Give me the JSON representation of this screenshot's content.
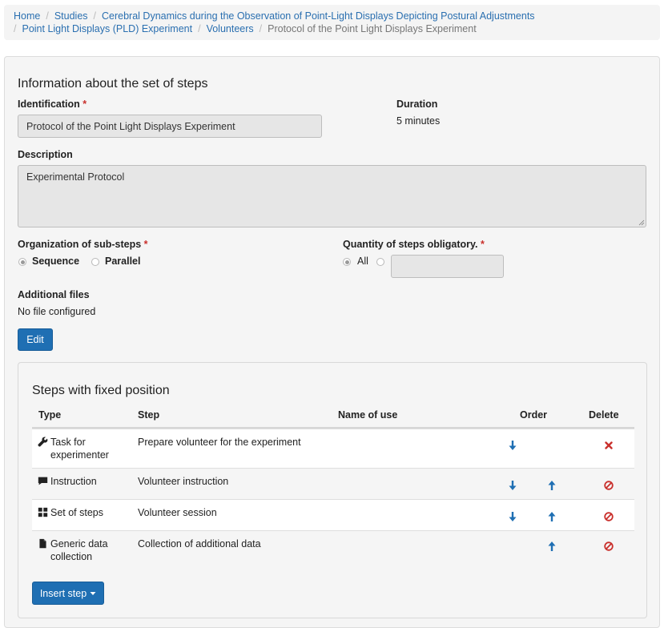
{
  "breadcrumb": {
    "items": [
      "Home",
      "Studies",
      "Cerebral Dynamics during the Observation of Point-Light Displays Depicting Postural Adjustments",
      "Point Light Displays (PLD) Experiment",
      "Volunteers"
    ],
    "current": "Protocol of the Point Light Displays Experiment"
  },
  "form": {
    "title": "Information about the set of steps",
    "identification_label": "Identification",
    "identification_value": "Protocol of the Point Light Displays Experiment",
    "duration_label": "Duration",
    "duration_value": "5 minutes",
    "description_label": "Description",
    "description_value": "Experimental Protocol",
    "organization_label": "Organization of sub-steps",
    "organization_options": [
      "Sequence",
      "Parallel"
    ],
    "organization_selected": "Sequence",
    "quantity_label": "Quantity of steps obligatory.",
    "quantity_options": [
      "All"
    ],
    "quantity_selected": "All",
    "quantity_value": "",
    "required_mark": "*",
    "files_label": "Additional files",
    "files_value": "No file configured",
    "edit_button": "Edit"
  },
  "steps": {
    "title": "Steps with fixed position",
    "columns": [
      "Type",
      "Step",
      "Name of use",
      "Order",
      "Delete"
    ],
    "rows": [
      {
        "type": "Task for experimenter",
        "type_icon": "wrench-icon",
        "step": "Prepare volunteer for the experiment",
        "name_of_use": "",
        "down": true,
        "up": false,
        "delete_icon": "remove-icon"
      },
      {
        "type": "Instruction",
        "type_icon": "comment-icon",
        "step": "Volunteer instruction",
        "name_of_use": "",
        "down": true,
        "up": true,
        "delete_icon": "ban-icon"
      },
      {
        "type": "Set of steps",
        "type_icon": "grid-icon",
        "step": "Volunteer session",
        "name_of_use": "",
        "down": true,
        "up": true,
        "delete_icon": "ban-icon"
      },
      {
        "type": "Generic data collection",
        "type_icon": "file-icon",
        "step": "Collection of additional data",
        "name_of_use": "",
        "down": false,
        "up": true,
        "delete_icon": "ban-icon"
      }
    ],
    "insert_button": "Insert step"
  },
  "colors": {
    "link": "#2a6fb0",
    "primary": "#1f6fb3",
    "danger": "#c9302c"
  }
}
